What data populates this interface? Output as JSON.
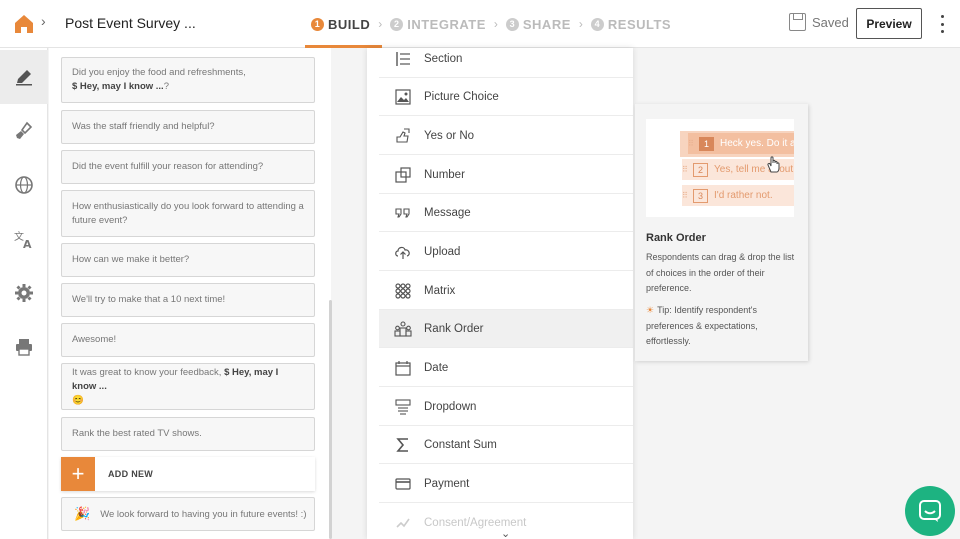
{
  "header": {
    "survey_title": "Post Event Survey ...",
    "steps": [
      {
        "num": "1",
        "label": "BUILD",
        "active": true
      },
      {
        "num": "2",
        "label": "INTEGRATE",
        "active": false
      },
      {
        "num": "3",
        "label": "SHARE",
        "active": false
      },
      {
        "num": "4",
        "label": "RESULTS",
        "active": false
      }
    ],
    "saved_label": "Saved",
    "preview_label": "Preview"
  },
  "rail": {
    "icons": [
      "edit-icon",
      "paint-brush-icon",
      "globe-icon",
      "translate-icon",
      "gear-icon",
      "printer-icon"
    ]
  },
  "questions": [
    {
      "text": "Did you enjoy the food and refreshments,",
      "bold": "$ Hey, may I know ...",
      "tail": "?"
    },
    {
      "text": "Was the staff friendly and helpful?"
    },
    {
      "text": "Did the event fulfill your reason for attending?"
    },
    {
      "text": "How enthusiastically do you look forward to attending a future event?"
    },
    {
      "text": "How can we make it better?"
    },
    {
      "text": "We'll try to make that a 10 next time!"
    },
    {
      "text": "Awesome!"
    },
    {
      "text": "It was great to know your feedback,",
      "bold": "$ Hey, may I know ...",
      "emoji": "😊"
    },
    {
      "text": "Rank the best rated TV shows."
    }
  ],
  "add_new_label": "ADD NEW",
  "end_message": "We look forward to having you in future events! :)",
  "menu": {
    "items": [
      {
        "label": "Section",
        "icon": "section-icon"
      },
      {
        "label": "Picture Choice",
        "icon": "picture-icon"
      },
      {
        "label": "Yes or No",
        "icon": "yes-no-icon"
      },
      {
        "label": "Number",
        "icon": "number-icon"
      },
      {
        "label": "Message",
        "icon": "quote-icon"
      },
      {
        "label": "Upload",
        "icon": "cloud-upload-icon"
      },
      {
        "label": "Matrix",
        "icon": "matrix-icon"
      },
      {
        "label": "Rank Order",
        "icon": "rank-order-icon"
      },
      {
        "label": "Date",
        "icon": "calendar-icon"
      },
      {
        "label": "Dropdown",
        "icon": "dropdown-icon"
      },
      {
        "label": "Constant Sum",
        "icon": "sigma-icon"
      },
      {
        "label": "Payment",
        "icon": "card-icon"
      },
      {
        "label": "Consent/Agreement",
        "icon": "consent-icon"
      }
    ],
    "highlighted": "Rank Order"
  },
  "preview": {
    "options": [
      {
        "num": "1",
        "text": "Heck yes. Do it al"
      },
      {
        "num": "2",
        "text": "Yes, tell me about"
      },
      {
        "num": "3",
        "text": "I'd rather not."
      }
    ],
    "title": "Rank Order",
    "description": "Respondents can drag & drop the list of choices in the order of their preference.",
    "tip": "Tip: Identify respondent's preferences & expectations, effortlessly."
  },
  "colors": {
    "accent": "#e8883a",
    "chat": "#1db381"
  }
}
